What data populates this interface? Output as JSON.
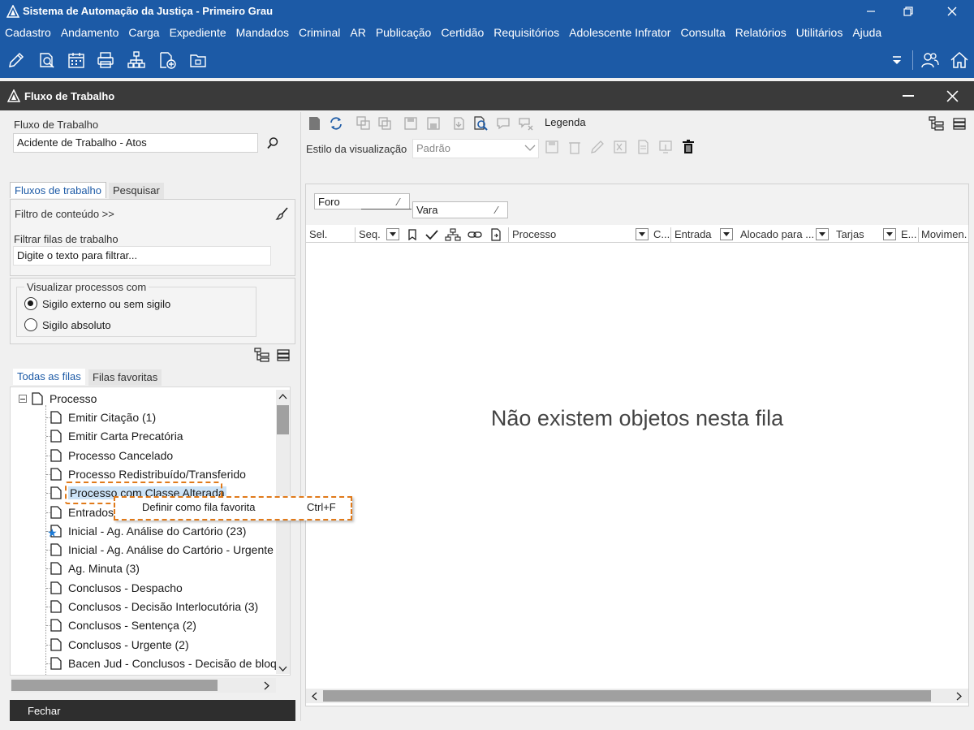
{
  "window": {
    "title": "Sistema de Automação da Justiça - Primeiro Grau",
    "logo_icon": "saj-logo-icon"
  },
  "menu": [
    "Cadastro",
    "Andamento",
    "Carga",
    "Expediente",
    "Mandados",
    "Criminal",
    "AR",
    "Publicação",
    "Certidão",
    "Requisitórios",
    "Adolescente Infrator",
    "Consulta",
    "Relatórios",
    "Utilitários",
    "Ajuda"
  ],
  "inner_window": {
    "title": "Fluxo de Trabalho"
  },
  "left": {
    "workflow_label": "Fluxo de Trabalho",
    "workflow_value": "Acidente de Trabalho - Atos",
    "tabs": [
      "Fluxos de trabalho",
      "Pesquisar"
    ],
    "content_filter": "Filtro de conteúdo >>",
    "filter_label": "Filtrar filas de trabalho",
    "filter_placeholder": "Digite o texto para filtrar...",
    "visualize_label": "Visualizar processos com",
    "radio_options": [
      {
        "label": "Sigilo externo ou sem sigilo",
        "checked": true
      },
      {
        "label": "Sigilo absoluto",
        "checked": false
      }
    ],
    "queue_tabs": [
      "Todas as filas",
      "Filas favoritas"
    ],
    "tree_root": "Processo",
    "tree_items": [
      "Emitir Citação (1)",
      "Emitir Carta Precatória",
      "Processo Cancelado",
      "Processo Redistribuído/Transferido",
      "Processo com Classe Alterada",
      "Entrados",
      "Inicial - Ag. Análise do Cartório (23)",
      "Inicial - Ag. Análise do Cartório - Urgente",
      "Ag. Minuta (3)",
      "Conclusos - Despacho",
      "Conclusos - Decisão Interlocutória (3)",
      "Conclusos - Sentença (2)",
      "Conclusos - Urgente (2)",
      "Bacen Jud - Conclusos - Decisão de bloqu"
    ],
    "close_button": "Fechar"
  },
  "right": {
    "legend_label": "Legenda",
    "view_style_label": "Estilo da visualização",
    "view_style_value": "Padrão",
    "group_headers": [
      "Foro",
      "Vara"
    ],
    "columns": [
      "Sel.",
      "Seq.",
      "Processo",
      "C...",
      "Entrada",
      "Alocado para ...",
      "Tarjas",
      "E...",
      "Movimen..."
    ],
    "empty_message": "Não existem objetos nesta fila"
  },
  "context_menu": {
    "item": "Definir como fila favorita",
    "shortcut": "Ctrl+F"
  },
  "colors": {
    "brand_blue": "#1c5aa6",
    "dark_header": "#3a3a3a",
    "highlight_orange": "#e07a1a"
  }
}
